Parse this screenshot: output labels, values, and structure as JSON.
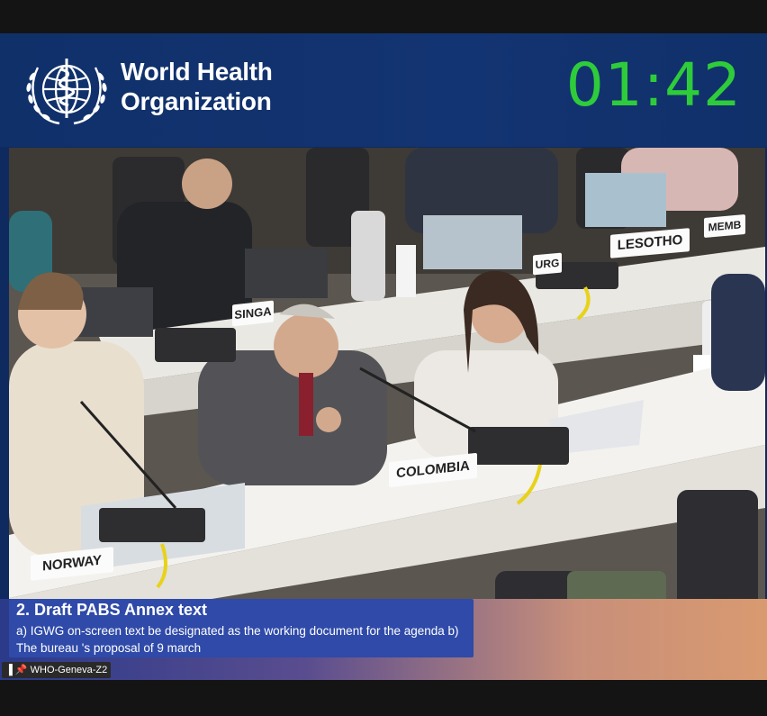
{
  "header": {
    "org_line1": "World Health",
    "org_line2": "Organization",
    "timer": "01:42"
  },
  "agenda": {
    "title": "2. Draft PABS Annex text",
    "body": "a) IGWG on-screen text be designated as the working document for the agenda b) The bureau 's proposal of 9 march"
  },
  "stream": {
    "label": "WHO-Geneva-Z2"
  },
  "nameplates": {
    "norway": "NORWAY",
    "colombia": "COLOMBIA",
    "lesotho": "LESOTHO",
    "singapore": "SINGA",
    "luxembourg": "URG",
    "member": "MEMB"
  },
  "colors": {
    "banner": "#133472",
    "timer": "#2ecc3a",
    "caption": "#2f4aa8"
  }
}
